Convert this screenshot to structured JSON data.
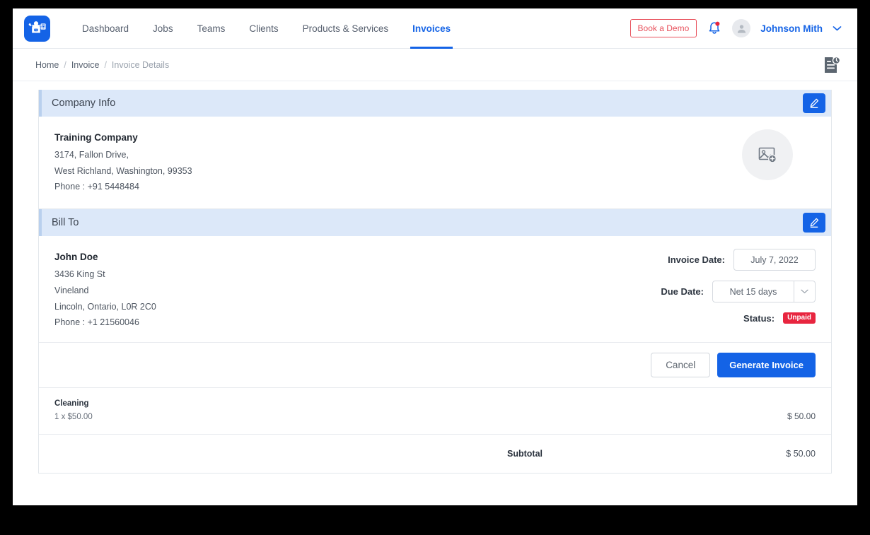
{
  "nav": {
    "logo_icon": "worker-logo-icon",
    "items": [
      {
        "label": "Dashboard",
        "active": false
      },
      {
        "label": "Jobs",
        "active": false
      },
      {
        "label": "Teams",
        "active": false
      },
      {
        "label": "Clients",
        "active": false
      },
      {
        "label": "Products & Services",
        "active": false
      },
      {
        "label": "Invoices",
        "active": true
      }
    ],
    "demo_button": "Book a Demo",
    "bell_icon": "notification-bell-icon",
    "avatar_icon": "user-avatar-icon",
    "user_name": "Johnson Mith",
    "caret_icon": "chevron-down-icon"
  },
  "breadcrumb": {
    "items": [
      "Home",
      "Invoice",
      "Invoice Details"
    ],
    "separator": "/",
    "history_icon": "document-history-icon"
  },
  "company_info": {
    "section_title": "Company Info",
    "edit_icon": "pencil-edit-icon",
    "name": "Training Company",
    "address_line1": "3174, Fallon Drive,",
    "address_line2": "West Richland, Washington, 99353",
    "phone": "Phone : +91 5448484",
    "image_placeholder_icon": "add-image-icon"
  },
  "bill_to": {
    "section_title": "Bill To",
    "edit_icon": "pencil-edit-icon",
    "name": "John Doe",
    "address_line1": "3436 King St",
    "address_line2": "Vineland",
    "address_line3": "Lincoln, Ontario, L0R 2C0",
    "phone": "Phone : +1 21560046",
    "invoice_date_label": "Invoice Date:",
    "invoice_date_value": "July 7, 2022",
    "due_date_label": "Due Date:",
    "due_date_value": "Net 15 days",
    "due_date_caret": "chevron-down-icon",
    "status_label": "Status:",
    "status_value": "Unpaid"
  },
  "actions": {
    "cancel_label": "Cancel",
    "generate_label": "Generate Invoice"
  },
  "line_items": [
    {
      "name": "Cleaning",
      "qty": "1 x $50.00",
      "amount": "$ 50.00"
    }
  ],
  "totals": {
    "subtotal_label": "Subtotal",
    "subtotal_amount": "$ 50.00"
  },
  "colors": {
    "brand_blue": "#1463e6",
    "section_header_bg": "#dce8f9",
    "status_red": "#e8253f",
    "demo_red": "#e8505b"
  }
}
